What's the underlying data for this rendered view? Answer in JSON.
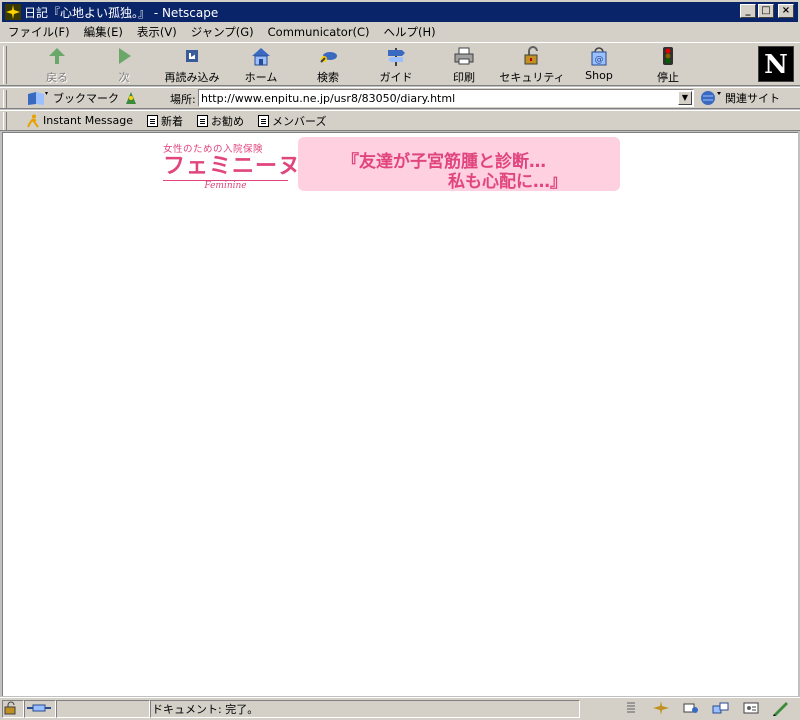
{
  "window": {
    "title": "日記『心地よい孤独。』 - Netscape",
    "buttons": [
      "_",
      "□",
      "×"
    ]
  },
  "menu": [
    "ファイル(F)",
    "編集(E)",
    "表示(V)",
    "ジャンプ(G)",
    "Communicator(C)",
    "ヘルプ(H)"
  ],
  "toolbar": {
    "back": "戻る",
    "forward": "次",
    "reload": "再読み込み",
    "home": "ホーム",
    "search": "検索",
    "guide": "ガイド",
    "print": "印刷",
    "security": "セキュリティ",
    "shop": "Shop",
    "stop": "停止",
    "logo": "N"
  },
  "location": {
    "bookmarks": "ブックマーク",
    "label": "場所:",
    "url": "http://www.enpitu.ne.jp/usr8/83050/diary.html",
    "related": "関連サイト"
  },
  "personal": [
    "Instant Message",
    "新着",
    "お勧め",
    "メンバーズ"
  ],
  "content": {
    "logo_sub": "女性のための入院保険",
    "logo_main": "フェミニーヌ",
    "logo_en": "Feminine",
    "ad_line1": "『友達が子宮筋腫と診断…",
    "ad_line2": "私も心配に…』"
  },
  "status": {
    "text": "ドキュメント: 完了。"
  },
  "colors": {
    "titlebar": "#0a246a",
    "chrome": "#d4d0c8",
    "accent_pink": "#e0457d",
    "ad_bg": "#ffd0e0"
  }
}
